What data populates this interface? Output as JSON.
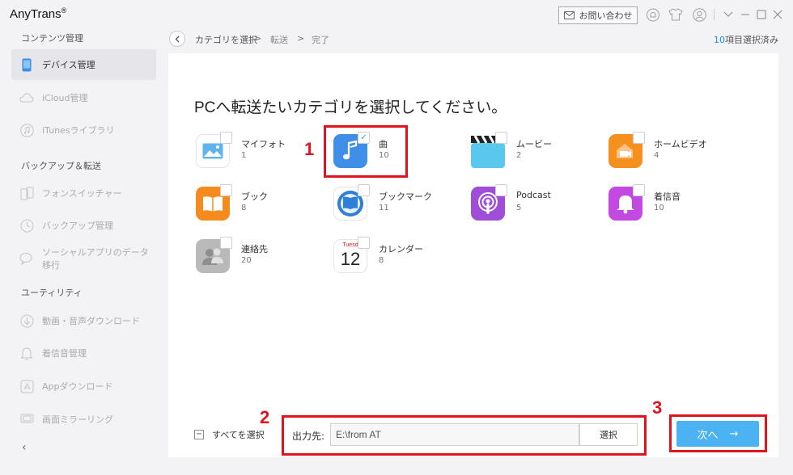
{
  "app": {
    "title": "AnyTrans",
    "trademark": "®"
  },
  "titlebar": {
    "contact_label": "お問い合わせ"
  },
  "sidebar": {
    "sections": [
      {
        "label": "コンテンツ管理"
      },
      {
        "label": "バックアップ＆転送"
      },
      {
        "label": "ユーティリティ"
      }
    ],
    "items": [
      {
        "label": "デバイス管理",
        "icon": "phone-icon",
        "active": true
      },
      {
        "label": "iCloud管理",
        "icon": "cloud-icon"
      },
      {
        "label": "iTunesライブラリ",
        "icon": "music-note-icon"
      },
      {
        "label": "フォンスイッチャー",
        "icon": "phone-switch-icon"
      },
      {
        "label": "バックアップ管理",
        "icon": "clock-icon"
      },
      {
        "label": "ソーシャルアプリのデータ移行",
        "icon": "chat-icon"
      },
      {
        "label": "動画・音声ダウンロード",
        "icon": "download-icon"
      },
      {
        "label": "着信音管理",
        "icon": "bell-icon"
      },
      {
        "label": "Appダウンロード",
        "icon": "app-store-icon"
      },
      {
        "label": "画面ミラーリング",
        "icon": "screen-icon"
      }
    ],
    "collapse_glyph": "‹"
  },
  "breadcrumb": {
    "steps": [
      "カテゴリを選択",
      "転送",
      "完了"
    ],
    "separator": ">",
    "selected_count": "10",
    "selected_suffix": "項目選択済み"
  },
  "main": {
    "heading": "PCへ転送たいカテゴリを選択してください。",
    "categories": [
      {
        "name": "マイフォト",
        "count": "1",
        "icon": "photo-icon",
        "color": "#5fb4f0",
        "checked": false
      },
      {
        "name": "曲",
        "count": "10",
        "icon": "music-icon",
        "color": "#3f8ee8",
        "checked": true
      },
      {
        "name": "ムービー",
        "count": "2",
        "icon": "clapperboard-icon",
        "color": "#5ac8ec",
        "checked": false
      },
      {
        "name": "ホームビデオ",
        "count": "4",
        "icon": "home-video-icon",
        "color": "#f5901f",
        "checked": false
      },
      {
        "name": "ブック",
        "count": "8",
        "icon": "book-icon",
        "color": "#f58a1f",
        "checked": false
      },
      {
        "name": "ブックマーク",
        "count": "11",
        "icon": "bookmark-icon",
        "color": "#2f7fd8",
        "checked": false
      },
      {
        "name": "Podcast",
        "count": "5",
        "icon": "podcast-icon",
        "color": "#a04ed8",
        "checked": false
      },
      {
        "name": "着信音",
        "count": "10",
        "icon": "bell-icon",
        "color": "#c449e0",
        "checked": false
      },
      {
        "name": "連絡先",
        "count": "20",
        "icon": "contacts-icon",
        "color": "#b9b9b9",
        "checked": false
      },
      {
        "name": "カレンダー",
        "count": "8",
        "icon": "calendar-icon",
        "color": "#ffffff",
        "checked": false
      }
    ],
    "calendar_icon": {
      "weekday": "Tuesd",
      "day": "12"
    }
  },
  "annotations": {
    "step1": "1",
    "step2": "2",
    "step3": "3"
  },
  "bottom": {
    "select_all_label": "すべてを選択",
    "select_all_glyph": "−",
    "output_label": "出力先:",
    "output_path": "E:\\from AT",
    "browse_label": "選択",
    "next_label": "次へ",
    "next_arrow": "→"
  },
  "colors": {
    "accent": "#4cb3f2",
    "annotation": "#e0141e",
    "link": "#1e88e5"
  }
}
